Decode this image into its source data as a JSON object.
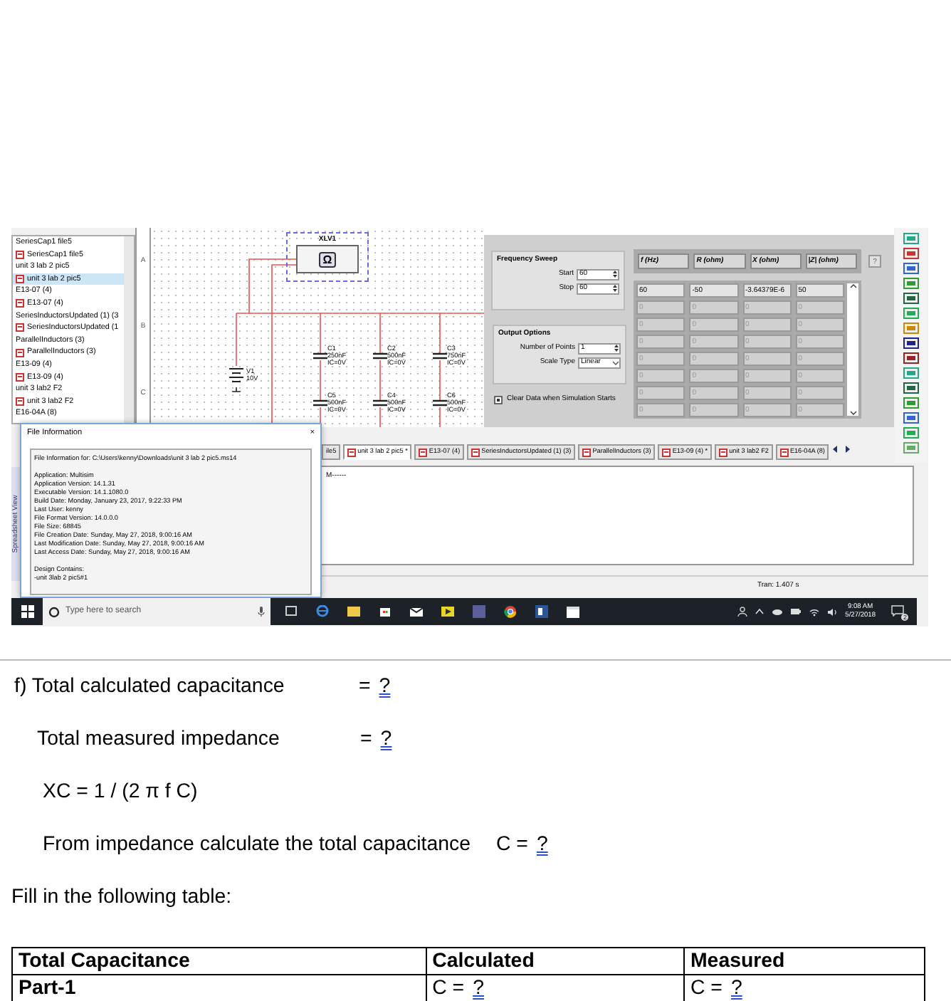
{
  "embedded_screenshot": {
    "design_toolbox": {
      "items": [
        {
          "label": "SeriesCap1 file5",
          "kind": "folder",
          "selected": false
        },
        {
          "label": "SeriesCap1 file5",
          "kind": "file",
          "selected": false
        },
        {
          "label": "unit 3 lab 2 pic5",
          "kind": "folder",
          "selected": false
        },
        {
          "label": "unit 3 lab 2 pic5",
          "kind": "file",
          "selected": true
        },
        {
          "label": "E13-07 (4)",
          "kind": "folder",
          "selected": false
        },
        {
          "label": "E13-07 (4)",
          "kind": "file",
          "selected": false
        },
        {
          "label": "SeriesInductorsUpdated (1) (3",
          "kind": "folder",
          "selected": false
        },
        {
          "label": "SeriesInductorsUpdated (1",
          "kind": "file",
          "selected": false
        },
        {
          "label": "ParallelInductors (3)",
          "kind": "folder",
          "selected": false
        },
        {
          "label": "ParallelInductors (3)",
          "kind": "file",
          "selected": false
        },
        {
          "label": "E13-09 (4)",
          "kind": "folder",
          "selected": false
        },
        {
          "label": "E13-09 (4)",
          "kind": "file",
          "selected": false
        },
        {
          "label": "unit 3 lab2 F2",
          "kind": "folder",
          "selected": false
        },
        {
          "label": "unit 3 lab2 F2",
          "kind": "file",
          "selected": false
        },
        {
          "label": "E16-04A (8)",
          "kind": "folder",
          "selected": false
        }
      ]
    },
    "schematic": {
      "row_labels": [
        "A",
        "B",
        "C"
      ],
      "instrument": {
        "label": "XLV1",
        "symbol": "Ω"
      },
      "source": {
        "name": "V1",
        "value": "10V"
      },
      "capacitors": [
        {
          "name": "C1",
          "value": "250nF",
          "condition": "IC=0V"
        },
        {
          "name": "C2",
          "value": "500nF",
          "condition": "IC=0V"
        },
        {
          "name": "C3",
          "value": "750nF",
          "condition": "IC=0V"
        },
        {
          "name": "C5",
          "value": "500nF",
          "condition": "IC=0V"
        },
        {
          "name": "C4",
          "value": "500nF",
          "condition": "IC=0V"
        },
        {
          "name": "C6",
          "value": "500nF",
          "condition": "IC=0V"
        }
      ]
    },
    "impedance_meter": {
      "frequency_sweep": {
        "title": "Frequency Sweep",
        "fields": [
          {
            "label": "Start",
            "value": "60",
            "kind": "spin"
          },
          {
            "label": "Stop",
            "value": "60",
            "kind": "spin"
          }
        ]
      },
      "output_options": {
        "title": "Output Options",
        "fields": [
          {
            "label": "Number of Points",
            "value": "1",
            "kind": "spin"
          },
          {
            "label": "Scale Type",
            "value": "Linear",
            "kind": "dropdown"
          }
        ]
      },
      "clear_data": {
        "label": "Clear Data when Simulation Starts",
        "checked": true
      },
      "columns": [
        "f (Hz)",
        "R (ohm)",
        "X (ohm)",
        "|Z| (ohm)"
      ],
      "help": "?",
      "rows": [
        [
          "60",
          "-50",
          "-3.64379E-6",
          "50"
        ],
        [
          "0",
          "0",
          "0",
          "0"
        ],
        [
          "0",
          "0",
          "0",
          "0"
        ],
        [
          "0",
          "0",
          "0",
          "0"
        ],
        [
          "0",
          "0",
          "0",
          "0"
        ],
        [
          "0",
          "0",
          "0",
          "0"
        ],
        [
          "0",
          "0",
          "0",
          "0"
        ],
        [
          "0",
          "0",
          "0",
          "0"
        ]
      ]
    },
    "tabs": [
      {
        "label": "ile5",
        "selected": false
      },
      {
        "label": "unit 3 lab 2 pic5 *",
        "selected": true
      },
      {
        "label": "E13-07 (4)",
        "selected": false
      },
      {
        "label": "SeriesInductorsUpdated (1) (3)",
        "selected": false
      },
      {
        "label": "ParallelInductors (3)",
        "selected": false
      },
      {
        "label": "E13-09 (4) *",
        "selected": false
      },
      {
        "label": "unit 3 lab2 F2",
        "selected": false
      },
      {
        "label": "E16-04A (8)",
        "selected": false
      }
    ],
    "output_pane": {
      "text": "M------"
    },
    "side_label": "Spreadsheet View",
    "status_bar": {
      "text": "Tran: 1.407 s"
    },
    "file_information_dialog": {
      "title": "File Information",
      "close": "×",
      "lines": [
        "File Information for: C:\\Users\\kenny\\Downloads\\unit 3 lab 2 pic5.ms14",
        "Application: Multisim",
        "Application Version: 14.1.31",
        "Executable Version: 14.1.1080.0",
        "Build Date: Monday, January 23, 2017, 9:22:33 PM",
        "Last User: kenny",
        "File Format Version: 14.0.0.0",
        "File Size: 68845",
        "File Creation Date: Sunday, May 27, 2018, 9:00:16 AM",
        "Last Modification Date: Sunday, May 27, 2018, 9:00:16 AM",
        "Last Access Date: Sunday, May 27, 2018, 9:00:16 AM",
        "Design Contains:",
        "-unit 3lab 2 pic5#1"
      ]
    },
    "taskbar": {
      "search_placeholder": "Type here to search",
      "time": "9:08 AM",
      "date": "5/27/2018",
      "notification_count": "2"
    }
  },
  "question": {
    "lines": [
      {
        "kind": "heading",
        "label": "f) Total calculated capacitance",
        "equals": "=",
        "blank": "?"
      },
      {
        "kind": "sub",
        "label": "Total measured impedance",
        "equals": "=",
        "blank": "?"
      },
      {
        "kind": "formula",
        "label": "XC = 1 / (2 π f C)"
      },
      {
        "kind": "inline",
        "label": "From impedance calculate the total capacitance",
        "equals": "C =",
        "blank": "?"
      },
      {
        "kind": "instruction",
        "label": "Fill in the following table:"
      }
    ]
  },
  "table": {
    "columns": [
      "Total Capacitance",
      "Calculated",
      "Measured"
    ],
    "rows": [
      [
        {
          "text": "Part-1"
        },
        {
          "text": "C =",
          "blank": "?"
        },
        {
          "text": "C =",
          "blank": "?"
        }
      ]
    ]
  }
}
